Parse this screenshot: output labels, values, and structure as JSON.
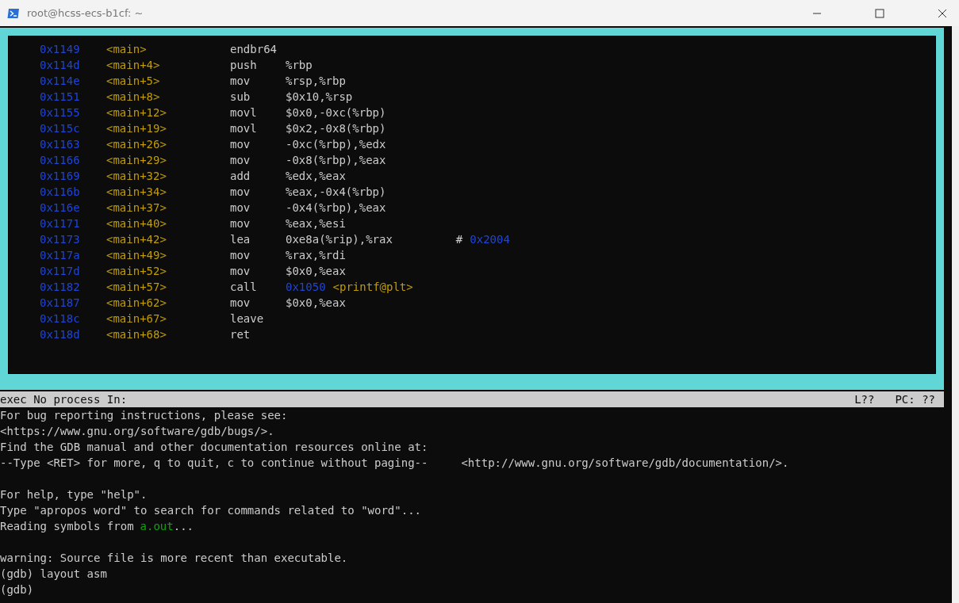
{
  "window": {
    "title": "root@hcss-ecs-b1cf: ~"
  },
  "asm": [
    {
      "address": "0x1149",
      "symbol": "<main>",
      "mnemonic": "endbr64"
    },
    {
      "address": "0x114d",
      "symbol": "<main+4>",
      "mnemonic": "push",
      "operands": [
        {
          "kind": "text",
          "text": "%rbp"
        }
      ]
    },
    {
      "address": "0x114e",
      "symbol": "<main+5>",
      "mnemonic": "mov",
      "operands": [
        {
          "kind": "text",
          "text": "%rsp,%rbp"
        }
      ]
    },
    {
      "address": "0x1151",
      "symbol": "<main+8>",
      "mnemonic": "sub",
      "operands": [
        {
          "kind": "text",
          "text": "$0x10,%rsp"
        }
      ]
    },
    {
      "address": "0x1155",
      "symbol": "<main+12>",
      "mnemonic": "movl",
      "operands": [
        {
          "kind": "text",
          "text": "$0x0,-0xc(%rbp)"
        }
      ]
    },
    {
      "address": "0x115c",
      "symbol": "<main+19>",
      "mnemonic": "movl",
      "operands": [
        {
          "kind": "text",
          "text": "$0x2,-0x8(%rbp)"
        }
      ]
    },
    {
      "address": "0x1163",
      "symbol": "<main+26>",
      "mnemonic": "mov",
      "operands": [
        {
          "kind": "text",
          "text": "-0xc(%rbp),%edx"
        }
      ]
    },
    {
      "address": "0x1166",
      "symbol": "<main+29>",
      "mnemonic": "mov",
      "operands": [
        {
          "kind": "text",
          "text": "-0x8(%rbp),%eax"
        }
      ]
    },
    {
      "address": "0x1169",
      "symbol": "<main+32>",
      "mnemonic": "add",
      "operands": [
        {
          "kind": "text",
          "text": "%edx,%eax"
        }
      ]
    },
    {
      "address": "0x116b",
      "symbol": "<main+34>",
      "mnemonic": "mov",
      "operands": [
        {
          "kind": "text",
          "text": "%eax,-0x4(%rbp)"
        }
      ]
    },
    {
      "address": "0x116e",
      "symbol": "<main+37>",
      "mnemonic": "mov",
      "operands": [
        {
          "kind": "text",
          "text": "-0x4(%rbp),%eax"
        }
      ]
    },
    {
      "address": "0x1171",
      "symbol": "<main+40>",
      "mnemonic": "mov",
      "operands": [
        {
          "kind": "text",
          "text": "%eax,%esi"
        }
      ]
    },
    {
      "address": "0x1173",
      "symbol": "<main+42>",
      "mnemonic": "lea",
      "operands": [
        {
          "kind": "text",
          "text": "0xe8a(%rip),%rax"
        },
        {
          "kind": "comment",
          "text": "#"
        },
        {
          "kind": "address",
          "text": "0x2004"
        }
      ]
    },
    {
      "address": "0x117a",
      "symbol": "<main+49>",
      "mnemonic": "mov",
      "operands": [
        {
          "kind": "text",
          "text": "%rax,%rdi"
        }
      ]
    },
    {
      "address": "0x117d",
      "symbol": "<main+52>",
      "mnemonic": "mov",
      "operands": [
        {
          "kind": "text",
          "text": "$0x0,%eax"
        }
      ]
    },
    {
      "address": "0x1182",
      "symbol": "<main+57>",
      "mnemonic": "call",
      "operands": [
        {
          "kind": "address",
          "text": "0x1050"
        },
        {
          "kind": "symbol",
          "text": "<printf@plt>"
        }
      ]
    },
    {
      "address": "0x1187",
      "symbol": "<main+62>",
      "mnemonic": "mov",
      "operands": [
        {
          "kind": "text",
          "text": "$0x0,%eax"
        }
      ]
    },
    {
      "address": "0x118c",
      "symbol": "<main+67>",
      "mnemonic": "leave"
    },
    {
      "address": "0x118d",
      "symbol": "<main+68>",
      "mnemonic": "ret"
    }
  ],
  "status_bar": {
    "left": "exec No process In:",
    "line": "L??",
    "pc": "PC: ??"
  },
  "console": [
    {
      "lines": [
        [
          {
            "kind": "plain",
            "text": "For bug reporting instructions, please see:"
          }
        ],
        [
          {
            "kind": "plain",
            "text": "<https://www.gnu.org/software/gdb/bugs/>."
          }
        ],
        [
          {
            "kind": "plain",
            "text": "Find the GDB manual and other documentation resources online at:"
          }
        ],
        [
          {
            "kind": "plain",
            "text": "--Type <RET> for more, q to quit, c to continue without paging--"
          },
          {
            "kind": "aside",
            "text": "<http://www.gnu.org/software/gdb/documentation/>."
          }
        ]
      ]
    },
    {
      "lines": [
        [
          {
            "kind": "plain",
            "text": "For help, type \"help\"."
          }
        ],
        [
          {
            "kind": "plain",
            "text": "Type \"apropos word\" to search for commands related to \"word\"..."
          }
        ],
        [
          {
            "kind": "plain",
            "text": "Reading symbols from"
          },
          {
            "kind": "file",
            "text": "a.out"
          },
          {
            "kind": "plain",
            "text": "..."
          }
        ]
      ]
    },
    {
      "lines": [
        [
          {
            "kind": "plain",
            "text": "warning: Source file is more recent than executable."
          }
        ],
        [
          {
            "kind": "plain",
            "text": "(gdb) layout asm"
          }
        ],
        [
          {
            "kind": "plain",
            "text": "(gdb)"
          }
        ]
      ]
    }
  ]
}
